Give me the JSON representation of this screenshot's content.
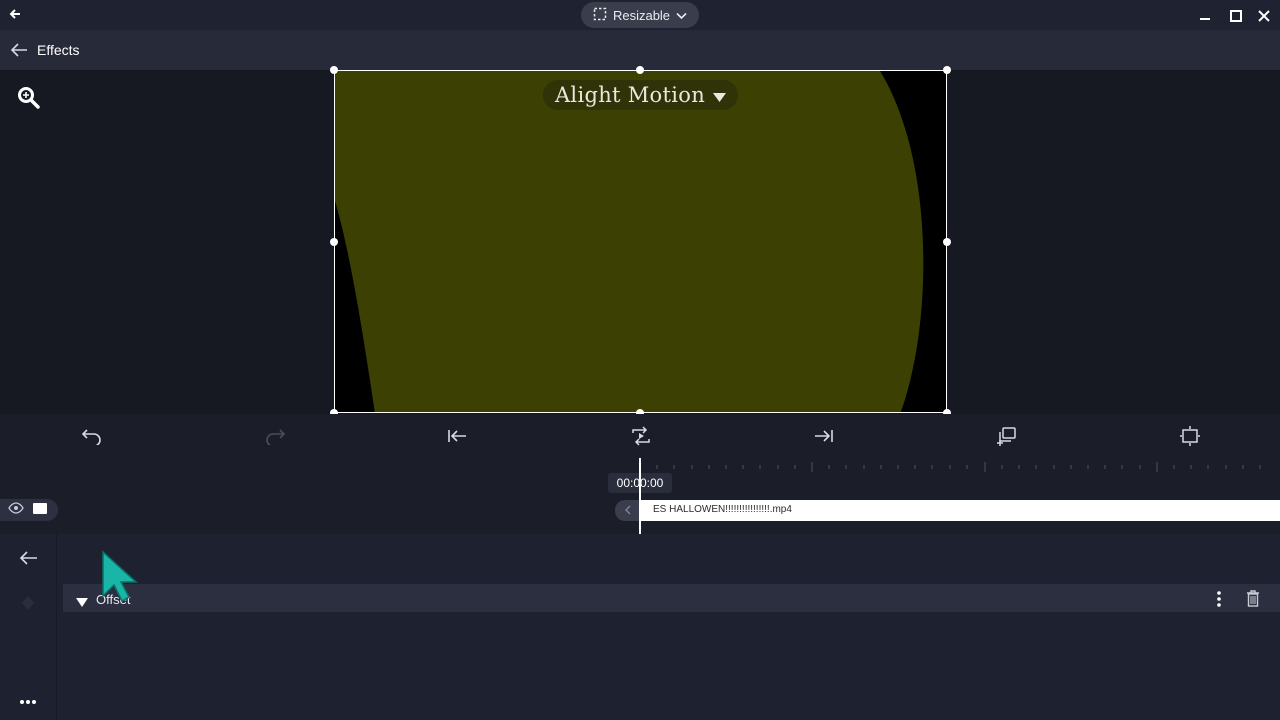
{
  "titlebar": {
    "mode_label": "Resizable",
    "icons": {
      "back": "arrow-left-icon",
      "resize": "resize-frame-icon",
      "chevron": "chevron-down-icon",
      "minimize": "minimize-icon",
      "maximize": "maximize-icon",
      "close": "close-icon"
    }
  },
  "header": {
    "title": "Effects",
    "back_icon": "arrow-left-icon"
  },
  "preview": {
    "watermark": "Alight Motion",
    "zoom_icon": "zoom-icon",
    "colors": {
      "fill": "#3c4002",
      "background": "#000000"
    }
  },
  "toolbar": {
    "items": [
      "undo-icon",
      "redo-icon",
      "jump-to-start-icon",
      "play-loop-icon",
      "jump-to-end-icon",
      "duplicate-icon",
      "fit-screen-icon"
    ]
  },
  "timeline": {
    "timecode": "00:00:00",
    "clip_name": "ES HALLOWEN!!!!!!!!!!!!!!!!.mp4"
  },
  "properties": {
    "section_label": "Offset",
    "icons": [
      "back-arrow-icon",
      "keyframe-icon",
      "more-icon",
      "delete-icon"
    ]
  },
  "colors": {
    "accent_cursor": "#19b5a6",
    "header_bg": "#262a39",
    "panel_bg": "#1d2130"
  }
}
